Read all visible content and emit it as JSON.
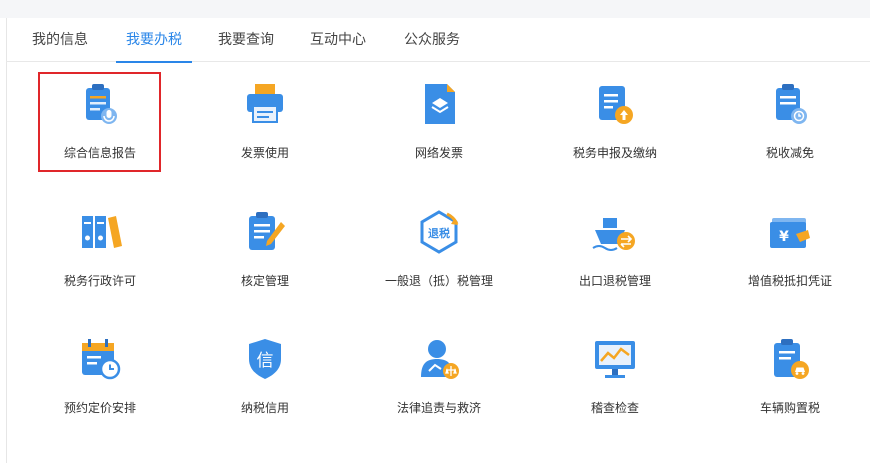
{
  "tabs": [
    {
      "label": "我的信息"
    },
    {
      "label": "我要办税"
    },
    {
      "label": "我要查询"
    },
    {
      "label": "互动中心"
    },
    {
      "label": "公众服务"
    }
  ],
  "active_tab": 1,
  "tiles": [
    {
      "label": "综合信息报告"
    },
    {
      "label": "发票使用"
    },
    {
      "label": "网络发票"
    },
    {
      "label": "税务申报及缴纳"
    },
    {
      "label": "税收减免"
    },
    {
      "label": "税务行政许可"
    },
    {
      "label": "核定管理"
    },
    {
      "label": "一般退（抵）税管理"
    },
    {
      "label": "出口退税管理"
    },
    {
      "label": "增值税抵扣凭证"
    },
    {
      "label": "预约定价安排"
    },
    {
      "label": "纳税信用"
    },
    {
      "label": "法律追责与救济"
    },
    {
      "label": "稽查检查"
    },
    {
      "label": "车辆购置税"
    }
  ],
  "icon_text": {
    "refund": "退税",
    "credit": "信",
    "yuan": "¥"
  },
  "colors": {
    "accent": "#2a86e8",
    "icon_blue": "#3a8ee6",
    "icon_orange": "#f5a623",
    "highlight_red": "#e0262a"
  }
}
